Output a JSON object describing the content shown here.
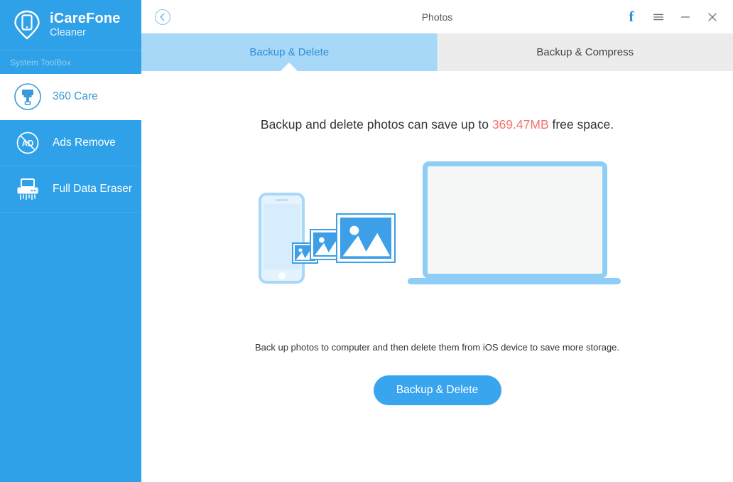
{
  "sidebar": {
    "brand": {
      "name": "iCareFone",
      "subtitle": "Cleaner",
      "logo_icon": "phone-pin-icon"
    },
    "section_label": "System ToolBox",
    "items": [
      {
        "label": "360 Care",
        "icon": "brush-circle-icon",
        "active": true
      },
      {
        "label": "Ads Remove",
        "icon": "ad-block-icon",
        "active": false
      },
      {
        "label": "Full Data Eraser",
        "icon": "shredder-icon",
        "active": false
      }
    ]
  },
  "titlebar": {
    "back_icon": "back-circle-icon",
    "title": "Photos",
    "controls": [
      {
        "name": "facebook-icon",
        "glyph": "f"
      },
      {
        "name": "menu-icon",
        "glyph": "☰"
      },
      {
        "name": "minimize-icon",
        "glyph": "−"
      },
      {
        "name": "close-icon",
        "glyph": "✕"
      }
    ]
  },
  "tabs": [
    {
      "label": "Backup & Delete",
      "active": true
    },
    {
      "label": "Backup & Compress",
      "active": false
    }
  ],
  "content": {
    "headline_prefix": "Backup and delete photos can save up to ",
    "headline_size": "369.47MB",
    "headline_suffix": " free space.",
    "sub_note": "Back up photos to computer and then delete them from iOS device to save more storage.",
    "cta_label": "Backup & Delete",
    "illustration": {
      "phone_icon": "iphone-icon",
      "photo_icons": [
        "photo-thumb-small-icon",
        "photo-thumb-medium-icon",
        "photo-thumb-large-icon"
      ],
      "laptop_icon": "laptop-icon"
    }
  },
  "colors": {
    "sidebar_blue": "#2fa1e8",
    "accent_blue": "#3aa5ef",
    "active_tab_blue": "#a8d8f7",
    "inactive_tab_gray": "#ececec",
    "size_red": "#f2736f"
  }
}
